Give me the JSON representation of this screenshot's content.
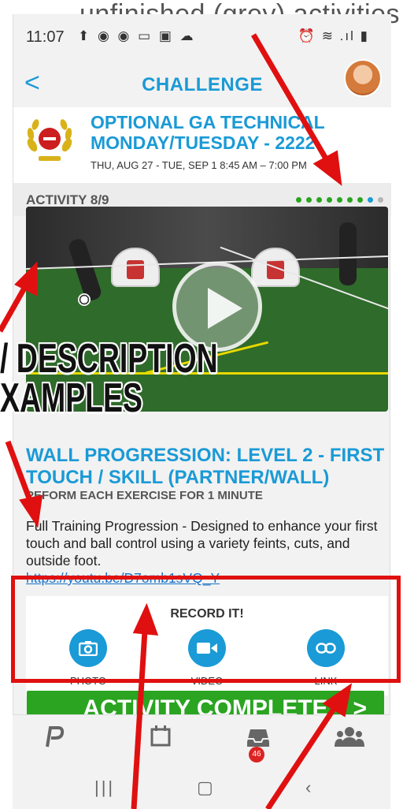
{
  "annotation": {
    "top_caption": "unfinished (grey) activities",
    "left_caption": "/ DESCRIPTION\nXAMPLES"
  },
  "status_bar": {
    "time": "11:07",
    "left_icons": "⬆ ◉ ◉ ▭ ▣ ☁",
    "right_icons": "⏰ ≋ .ıl ▮"
  },
  "header": {
    "back_label": "<",
    "title": "CHALLENGE"
  },
  "challenge": {
    "title": "OPTIONAL GA TECHNICAL MONDAY/TUESDAY - 2222",
    "dates": "THU, AUG 27 - TUE, SEP 1 8:45 AM – 7:00 PM"
  },
  "activity": {
    "counter": "ACTIVITY 8/9",
    "progress_dots": [
      "green",
      "green",
      "green",
      "green",
      "green",
      "green",
      "green",
      "blue",
      "grey"
    ],
    "title": "WALL PROGRESSION: LEVEL 2 - FIRST TOUCH / SKILL (PARTNER/WALL)",
    "subtitle": "PEFORM EACH EXERCISE FOR 1 MINUTE",
    "description": "Full Training Progression - Designed to enhance your first touch and ball control using a variety feints, cuts, and outside foot.",
    "link": "https://youtu.be/D7omb1sVQ_Y"
  },
  "record": {
    "title": "RECORD IT!",
    "items": [
      {
        "label": "PHOTO",
        "icon": "camera-icon"
      },
      {
        "label": "VIDEO",
        "icon": "video-camera-icon"
      },
      {
        "label": "LINK",
        "icon": "link-icon"
      }
    ]
  },
  "complete_button": {
    "label": "ACTIVITY COMPLETE",
    "chevron": ">"
  },
  "tabbar": {
    "notification_count": "46"
  },
  "colors": {
    "accent": "#1a9ad6",
    "complete": "#2aa421",
    "annotation_red": "#e01010"
  }
}
